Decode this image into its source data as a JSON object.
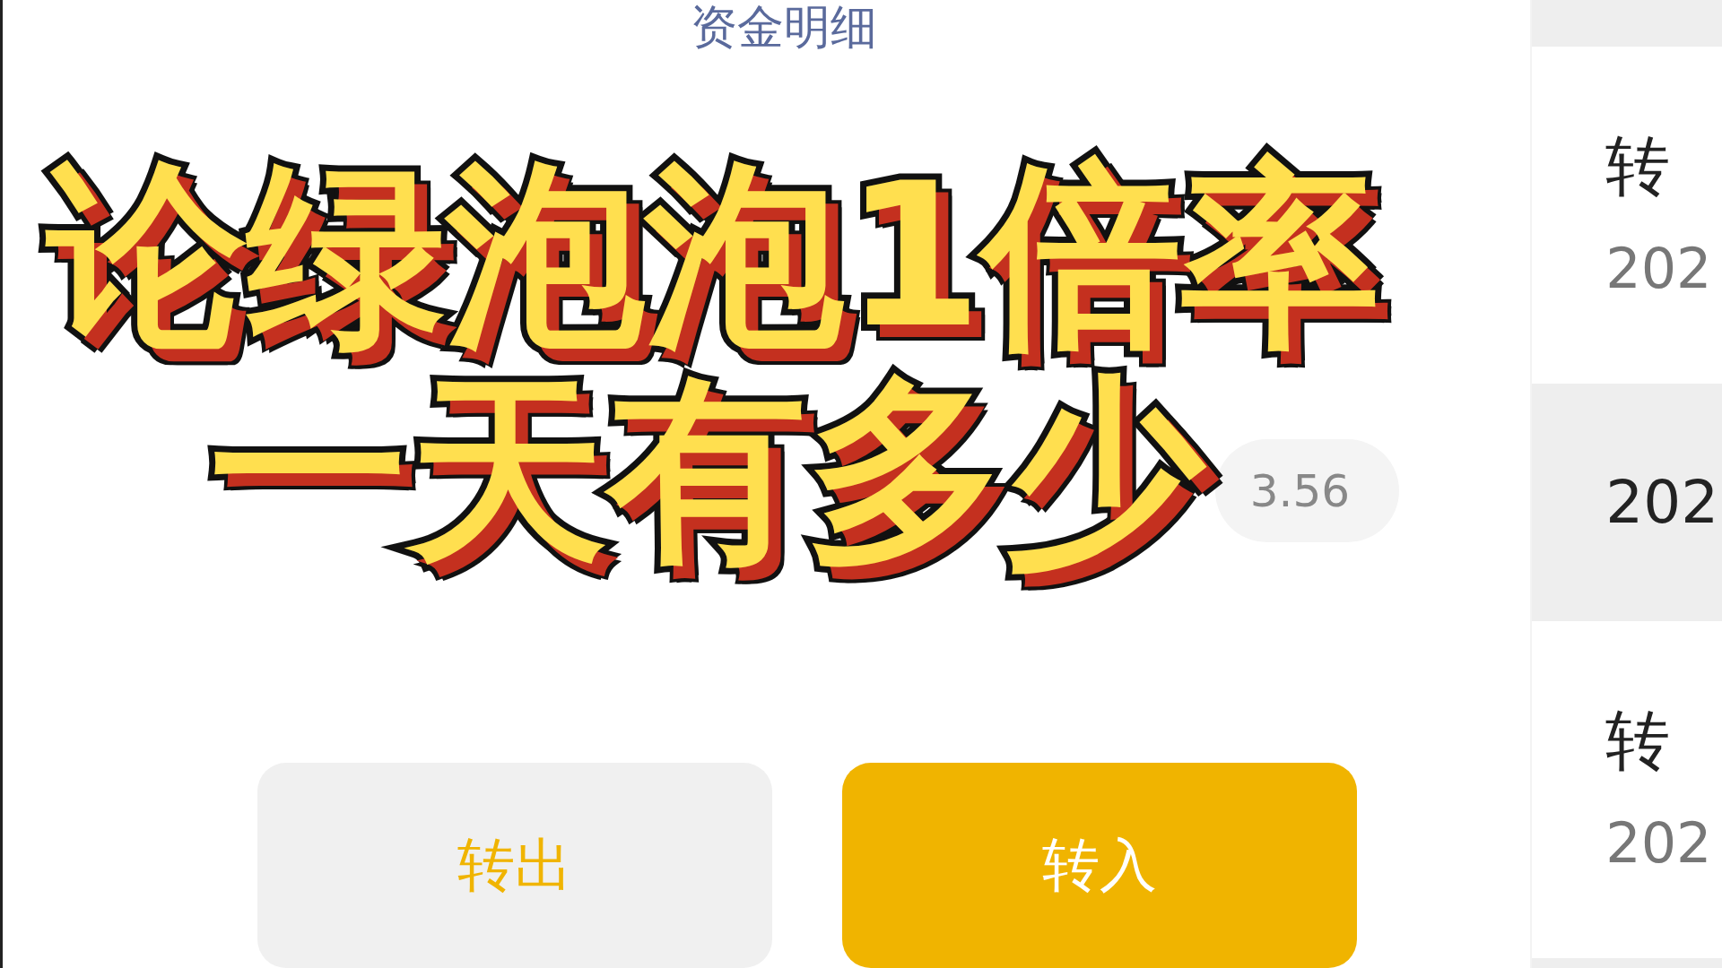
{
  "header": {
    "title": "资金明细"
  },
  "summary": {
    "chip": "3.56"
  },
  "buttons": [
    {
      "label": "转出",
      "kind": "secondary"
    },
    {
      "label": "转入",
      "kind": "primary"
    }
  ],
  "records": [
    {
      "type": "转",
      "date": "202",
      "highlighted": false
    },
    {
      "date": "202",
      "highlighted": true
    },
    {
      "type": "转",
      "date": "202",
      "highlighted": false
    }
  ],
  "overlay_title": {
    "lines": [
      "论绿泡泡1倍率",
      "一天有多少"
    ]
  }
}
